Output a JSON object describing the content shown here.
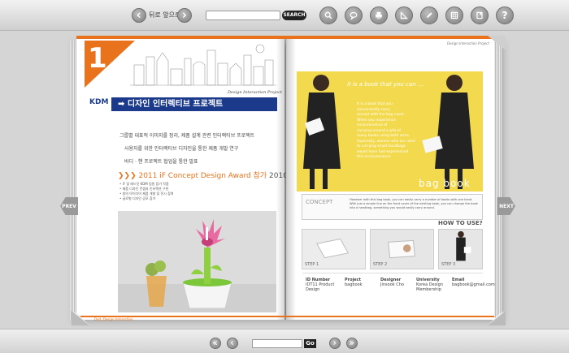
{
  "toolbar": {
    "nav_label": "뒤로 앞으로",
    "search_label": "SEARCH",
    "search_placeholder": ""
  },
  "left_page": {
    "chapter": "1",
    "subtitle": "Design Interaction Project",
    "brand": "KDM",
    "title": "➡ 디자인 인터렉티브 프로젝트",
    "bullets": [
      "그룹별 대표적 이미지를 정리, 제품 설계 관련 인터랙티브 프로젝트",
      "사용자를 위한 인터랙티브 디자인을 통한 제품 개발 연구",
      "바디 · 핸 프로젝트 협업을 통한 발표"
    ],
    "award_title": "2011 iF Concept Design Award 참가",
    "award_date": "2010. 11.",
    "award_lines": [
      "• iF 및 레드닷 KDM 팀원 참가 작품",
      "• 제품 디자인 컨셉과 인터랙션 구현",
      "• 창의 아이디어 제품 개발 및 전시 참여",
      "• 글로벌 디자인 공모 참가"
    ],
    "footer": "Doit. Design Interaction"
  },
  "right_page": {
    "header": "Design Interaction Project",
    "tagline": "it is a book that you can ....",
    "body_lines": [
      "It is a book that you",
      "conveniently carry",
      "around with the bag cover.",
      "When you experience",
      "inconvenience of",
      "carrying around a pile of",
      "many books using both arms.",
      "Especially, women who are used",
      "to carrying small handbags",
      "would have had experienced",
      "this inconvenience."
    ],
    "product_name": "bag book",
    "concept_label": "CONCEPT",
    "concept_text": "However with this bag book, you can easily carry a number of books with one hand. With just a simple line on the front cover of the existing book, you can change the book into a handbag, something you would easily carry around.",
    "howto": "HOW TO USE?",
    "steps": [
      "STEP 1",
      "STEP 2",
      "STEP 3"
    ],
    "credits": [
      {
        "label": "ID Number",
        "value": "IDT11 Product Design"
      },
      {
        "label": "Project",
        "value": "bagbook"
      },
      {
        "label": "Designer",
        "value": "Jinsook Cho"
      },
      {
        "label": "University",
        "value": "Korea Design Membership"
      },
      {
        "label": "Email",
        "value": "bagbook@gmail.com"
      }
    ]
  },
  "nav": {
    "prev_label": "PREV",
    "next_label": "NEXT",
    "go_label": "Go"
  },
  "colors": {
    "accent": "#e8731c",
    "title_blue": "#1b3a8c",
    "photo_yellow": "#f3d94d"
  }
}
